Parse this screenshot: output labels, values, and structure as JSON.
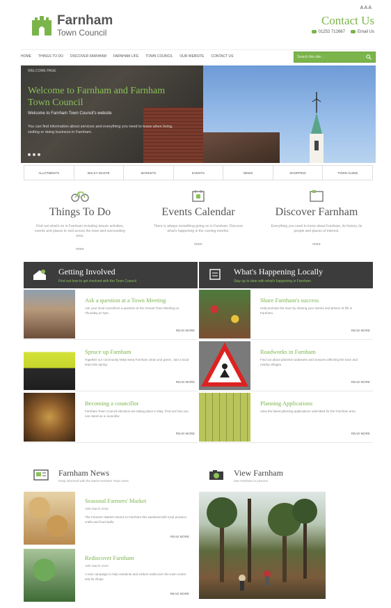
{
  "header": {
    "logo_name": "Farnham",
    "logo_sub": "Town Council",
    "util": "A A A",
    "contact_title": "Contact Us",
    "phone": "01252 712667",
    "email_label": "Email Us"
  },
  "nav": {
    "items": [
      "Home",
      "Things to do",
      "Discover Farnham",
      "Farnham Life",
      "Town Council",
      "Our Website",
      "Contact Us"
    ],
    "search_placeholder": "Search this site..."
  },
  "hero": {
    "crumb": "Welcome Page",
    "title": "Welcome to Farnham and Farnham Town Council",
    "subtitle": "Welcome to Farnham Town Council's website",
    "text": "You can find information about services and everything you need to know when living, visiting or doing business in Farnham."
  },
  "quick_links": [
    "Allotments",
    "Bulky Waste",
    "Markets",
    "Events",
    "News",
    "Shopping",
    "Town Guide"
  ],
  "features": [
    {
      "title": "Things To Do",
      "desc": "Find out what's on in Farnham including leisure activities, events and places to visit across the town and surrounding area.",
      "more": "more"
    },
    {
      "title": "Events Calendar",
      "desc": "There is always something going on in Farnham. Discover what's happening in the coming months.",
      "more": "more"
    },
    {
      "title": "Discover Farnham",
      "desc": "Everything you need to know about Farnham, its history, its people and places of interest.",
      "more": "more"
    }
  ],
  "getting_involved": {
    "title": "Getting Involved",
    "subtitle": "Find out how to get involved with the Town Council",
    "items": [
      {
        "title": "Ask a question at a Town Meeting",
        "text": "Ask your local councillors a question at the Annual Town Meeting on Thursday at 7pm.",
        "more": "Read more"
      },
      {
        "title": "Spruce up Farnham",
        "text": "Together our community helps keep Farnham clean and green. Join a local team this spring.",
        "more": "Read more"
      },
      {
        "title": "Becoming a councillor",
        "text": "Farnham Town Council elections are taking place in May. Find out how you can stand as a councillor.",
        "more": "Read more"
      }
    ]
  },
  "happening": {
    "title": "What's Happening Locally",
    "subtitle": "Stay up to date with what's happening in Farnham",
    "items": [
      {
        "title": "Share Farnham's success",
        "text": "Help promote the town by sharing your stories and photos of life in Farnham.",
        "more": "Read more"
      },
      {
        "title": "Roadworks in Farnham",
        "text": "Find out about planned roadworks and closures affecting the town and nearby villages.",
        "more": "Read more"
      },
      {
        "title": "Planning Applications",
        "text": "View the latest planning applications submitted for the Farnham area.",
        "more": "Read more"
      }
    ]
  },
  "news": {
    "title": "Farnham News",
    "subtitle": "Keep informed with the latest Farnham Town news",
    "items": [
      {
        "title": "Seasonal Farmers' Market",
        "date": "16th March 2015",
        "text": "The Farmers' Market returns to Farnham this weekend with local produce, crafts and food stalls.",
        "more": "Read more"
      },
      {
        "title": "Rediscover Farnham",
        "date": "10th March 2015",
        "text": "A new campaign to help residents and visitors rediscover the town centre and its shops.",
        "more": "Read more"
      }
    ]
  },
  "view": {
    "title": "View Farnham",
    "subtitle": "See Farnham in pictures"
  },
  "colors": {
    "accent": "#7bb44b",
    "dark": "#3c3c3c"
  }
}
